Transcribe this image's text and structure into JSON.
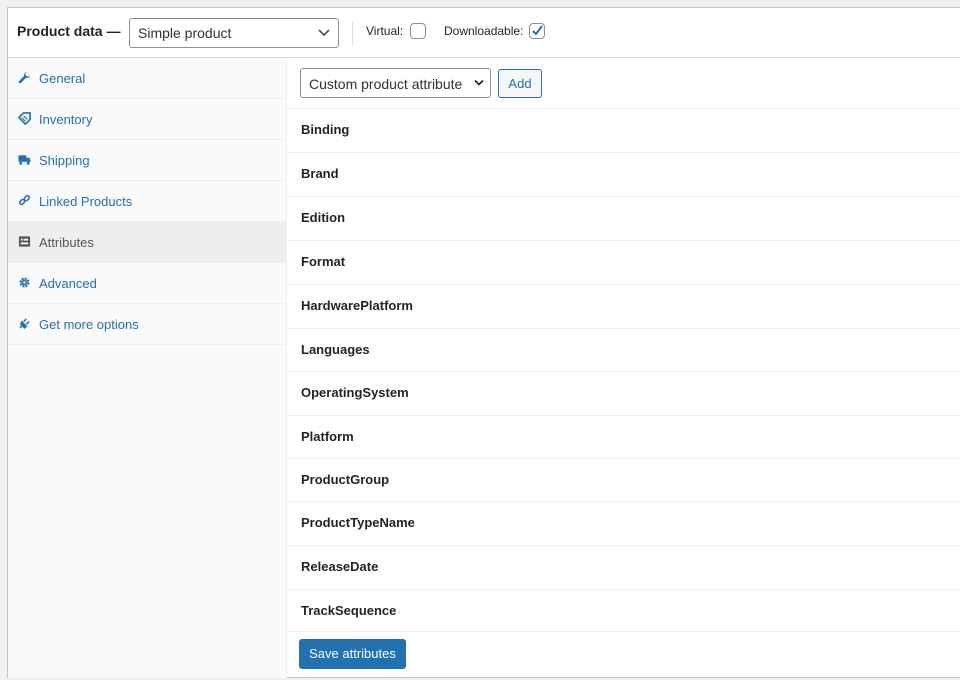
{
  "header": {
    "title": "Product data —",
    "product_type": "Simple product",
    "virtual_label": "Virtual:",
    "virtual_checked": false,
    "downloadable_label": "Downloadable:",
    "downloadable_checked": true
  },
  "sidebar": {
    "items": [
      {
        "label": "General",
        "icon": "wrench-icon",
        "active": false
      },
      {
        "label": "Inventory",
        "icon": "tag-icon",
        "active": false
      },
      {
        "label": "Shipping",
        "icon": "truck-icon",
        "active": false
      },
      {
        "label": "Linked Products",
        "icon": "link-icon",
        "active": false
      },
      {
        "label": "Attributes",
        "icon": "list-view-icon",
        "active": true
      },
      {
        "label": "Advanced",
        "icon": "gear-icon",
        "active": false
      },
      {
        "label": "Get more options",
        "icon": "plugin-icon",
        "active": false
      }
    ]
  },
  "attributes": {
    "select_value": "Custom product attribute",
    "add_label": "Add",
    "items": [
      "Binding",
      "Brand",
      "Edition",
      "Format",
      "HardwarePlatform",
      "Languages",
      "OperatingSystem",
      "Platform",
      "ProductGroup",
      "ProductTypeName",
      "ReleaseDate",
      "TrackSequence"
    ],
    "save_label": "Save attributes"
  },
  "colors": {
    "accent": "#2271b1",
    "sidebar_bg": "#fafafa",
    "active_bg": "#eeeeee",
    "border": "#c3c4c7"
  }
}
